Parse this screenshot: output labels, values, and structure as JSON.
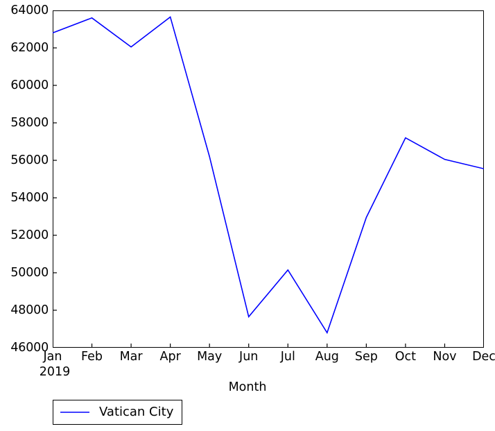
{
  "chart_data": {
    "type": "line",
    "title": "",
    "xlabel": "Month",
    "ylabel": "",
    "categories": [
      "Jan",
      "Feb",
      "Mar",
      "Apr",
      "May",
      "Jun",
      "Jul",
      "Aug",
      "Sep",
      "Oct",
      "Nov",
      "Dec"
    ],
    "x_sub_label": "2019",
    "series": [
      {
        "name": "Vatican City",
        "color": "#0000ff",
        "values": [
          62800,
          63600,
          62050,
          63650,
          56200,
          47650,
          50150,
          46800,
          52950,
          57200,
          56050,
          55550
        ]
      }
    ],
    "ylim": [
      46000,
      64000
    ],
    "ytick_values": [
      46000,
      48000,
      50000,
      52000,
      54000,
      56000,
      58000,
      60000,
      62000,
      64000
    ],
    "ytick_labels": [
      "46000",
      "48000",
      "50000",
      "52000",
      "54000",
      "56000",
      "58000",
      "60000",
      "62000",
      "64000"
    ],
    "grid": false,
    "legend_position": "below-left",
    "legend_entries": [
      "Vatican City"
    ]
  },
  "legend": {
    "entries": [
      {
        "label": "Vatican City",
        "color": "#0000ff"
      }
    ]
  },
  "axes": {
    "xlabel": "Month",
    "x_sub_label": "2019"
  },
  "colors": {
    "line": "#0000ff",
    "axis": "#000000",
    "background": "#ffffff"
  }
}
